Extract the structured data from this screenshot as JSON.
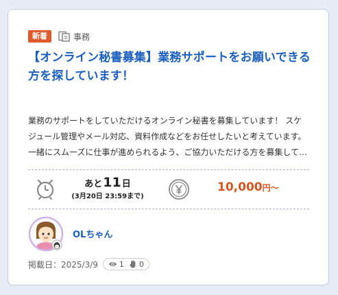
{
  "card": {
    "badge": "新着",
    "category": {
      "icon": "category-icon",
      "label": "事務"
    },
    "title": "【オンライン秘書募集】業務サポートをお願いできる方を探しています！",
    "description": "業務のサポートをしていただけるオンライン秘書を募集しています！ スケジュール管理やメール対応、資料作成などをお任せしたいと考えています。 一緒にスムーズに仕事が進められるよう、ご協力いただける方を募集しています。",
    "deadline": {
      "icon": "clock-icon",
      "prefix": "あと",
      "days": "11",
      "suffix": "日",
      "date": "(3月20日 23:59まで)"
    },
    "price": {
      "icon": "yen-icon",
      "amount": "10,000",
      "unit": "円〜"
    },
    "user": {
      "name": "OLちゃん",
      "avatar": "avatar"
    },
    "posted": "掲載日：2025/3/9",
    "stats": {
      "views": "1",
      "likes": "0"
    }
  },
  "colors": {
    "accent": "#1b5fbf",
    "badge": "#e0592a",
    "price": "#d9551f"
  }
}
